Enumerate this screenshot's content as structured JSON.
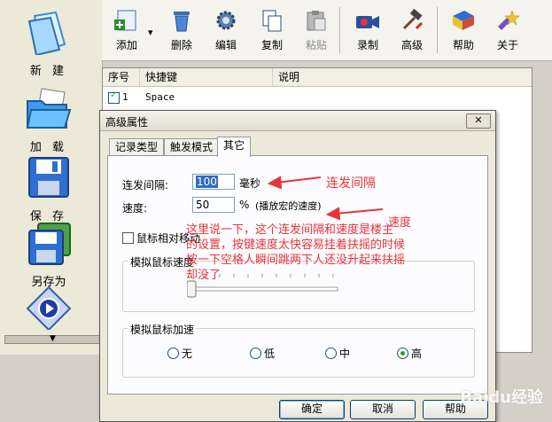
{
  "sidebar": {
    "items": [
      {
        "label": "新  建",
        "icon": "new-document-icon"
      },
      {
        "label": "加  载",
        "icon": "open-folder-icon"
      },
      {
        "label": "保  存",
        "icon": "floppy-disk-icon"
      },
      {
        "label": "另存为",
        "icon": "save-as-icon"
      },
      {
        "label": "",
        "icon": "play-icon"
      }
    ],
    "scroll_glyph": "▼"
  },
  "toolbar": {
    "buttons": [
      {
        "label": "添加",
        "icon": "add-icon"
      },
      {
        "label": "删除",
        "icon": "trash-icon"
      },
      {
        "label": "编辑",
        "icon": "gear-icon"
      },
      {
        "label": "复制",
        "icon": "copy-icon"
      },
      {
        "label": "粘贴",
        "icon": "paste-icon"
      },
      {
        "label": "录制",
        "icon": "record-camera-icon"
      },
      {
        "label": "高级",
        "icon": "advanced-tools-icon"
      },
      {
        "label": "帮助",
        "icon": "help-book-icon"
      },
      {
        "label": "关于",
        "icon": "about-icon"
      }
    ],
    "dropdown_glyph": "▾"
  },
  "list": {
    "columns": [
      "序号",
      "快捷键",
      "说明"
    ],
    "rows": [
      {
        "checked": true,
        "index": "1",
        "key": "Space",
        "desc": ""
      }
    ]
  },
  "dialog": {
    "title": "高级属性",
    "close_glyph": "✕",
    "tabs": [
      "记录类型",
      "触发模式",
      "其它"
    ],
    "active_tab": "其它",
    "interval_label": "连发间隔:",
    "interval_value": "100",
    "interval_unit": "毫秒",
    "speed_label": "速度:",
    "speed_value": "50",
    "speed_unit": "%",
    "speed_note": "(播放宏的速度)",
    "mouse_relative_label": "鼠标相对移动",
    "mouse_speed_group": "模拟鼠标速度",
    "mouse_speed_level": 0.0,
    "mouse_accel_group": "模拟鼠标加速",
    "accel_options": [
      "无",
      "低",
      "中",
      "高"
    ],
    "accel_selected": "高",
    "buttons": {
      "ok": "确定",
      "cancel": "取消",
      "help": "帮助"
    }
  },
  "annotations": {
    "interval": "连发间隔",
    "speed": "速度",
    "note_lines": [
      "这里说一下，这个连发间隔和速度是楼主",
      "的设置，按键速度太快容易挂着扶摇的时候",
      "按一下空格人瞬间跳两下人还没升起来扶摇",
      "却没了"
    ],
    "color": "#e8333b"
  },
  "watermark": "Baidu经验"
}
